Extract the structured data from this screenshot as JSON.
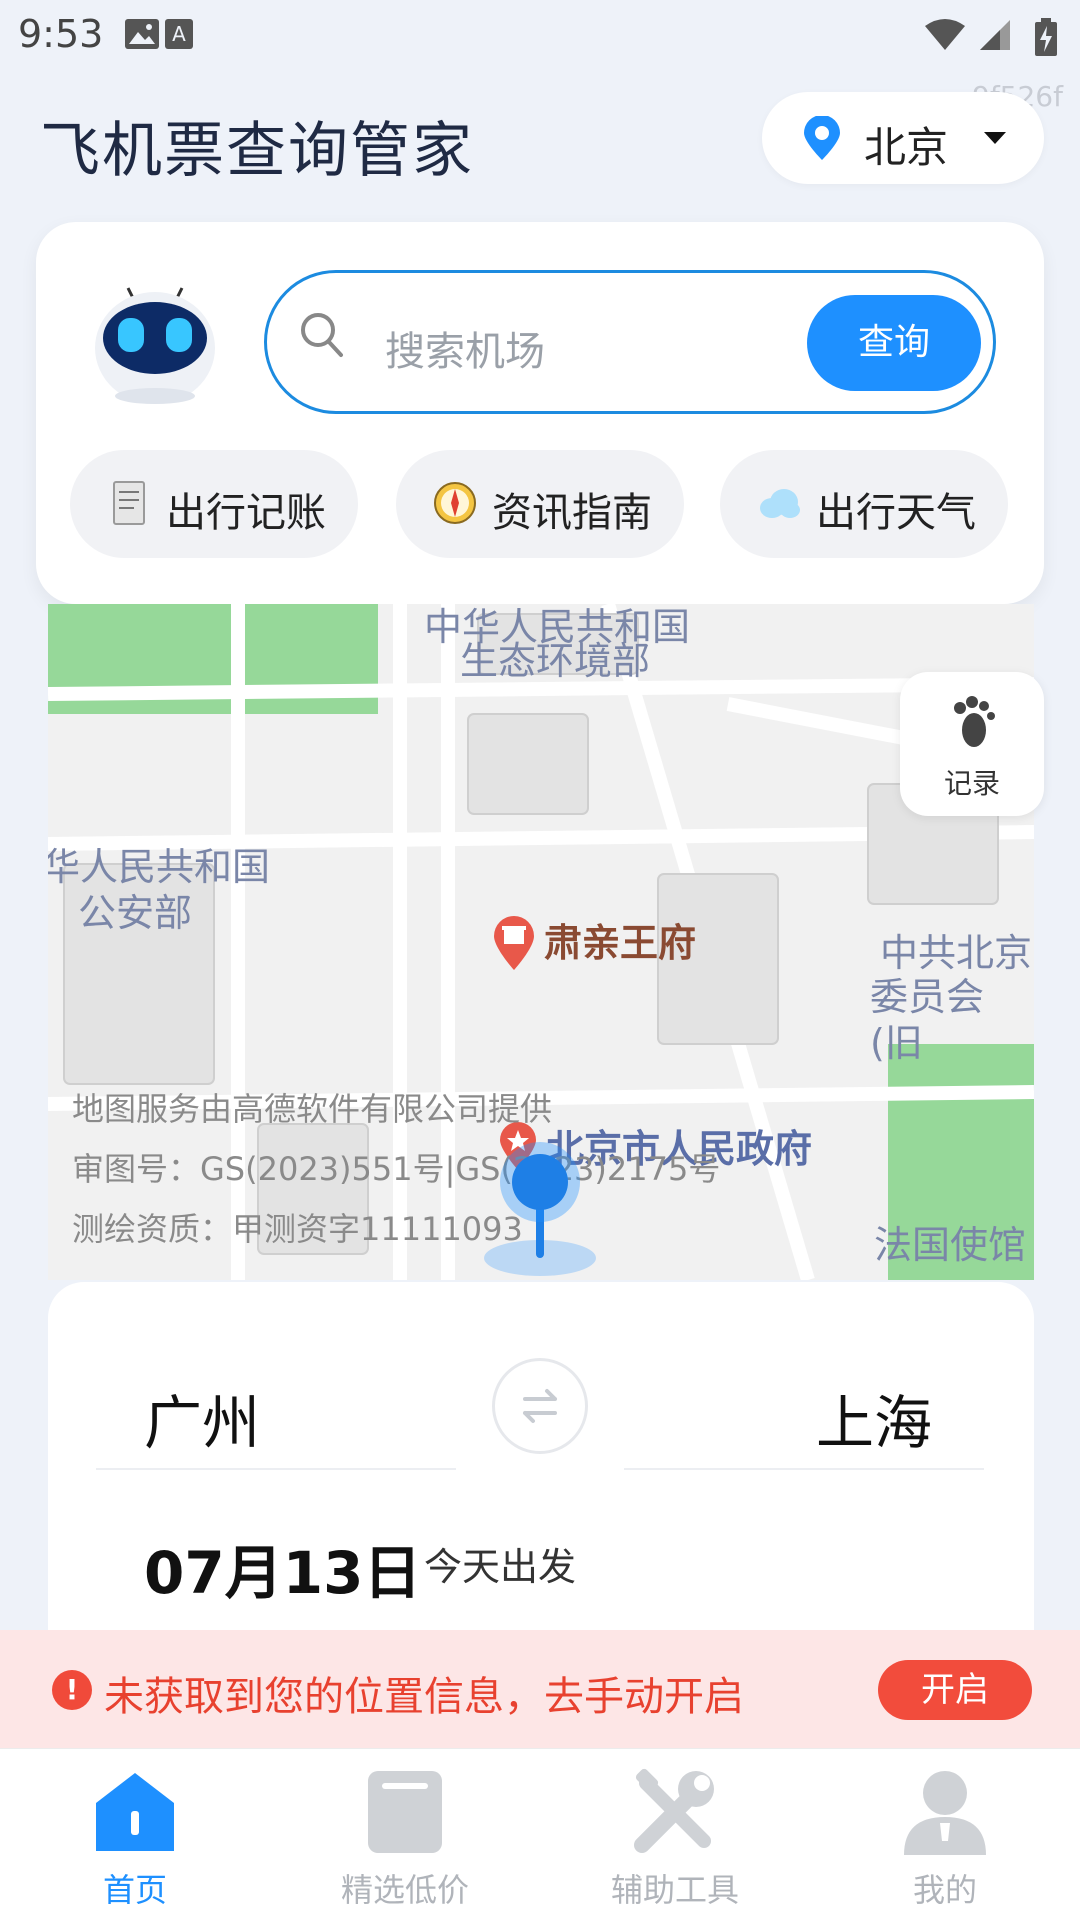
{
  "status_bar": {
    "time": "9:53"
  },
  "header": {
    "title": "飞机票查询管家",
    "city": "北京",
    "watermark": "9f526f"
  },
  "search": {
    "placeholder": "搜索机场",
    "button": "查询"
  },
  "quick_actions": [
    {
      "label": "出行记账",
      "icon": "receipt-icon"
    },
    {
      "label": "资讯指南",
      "icon": "compass-icon"
    },
    {
      "label": "出行天气",
      "icon": "cloud-icon"
    }
  ],
  "map": {
    "labels": {
      "ministry_env_line1": "中华人民共和国",
      "ministry_env_line2": "生态环境部",
      "ministry_security_line1": "华人民共和国",
      "ministry_security_line2": "公安部",
      "prince_mansion": "肃亲王府",
      "municipal_gov": "北京市人民政府",
      "party_committee_line1": "中共北京",
      "party_committee_line2": "委员会(旧",
      "embassy": "法国使馆"
    },
    "credits": [
      "地图服务由高德软件有限公司提供",
      "审图号：GS(2023)551号|GS(2023)2175号",
      "测绘资质：甲测资字11111093"
    ],
    "records_label": "记录"
  },
  "booking": {
    "from_city": "广州",
    "to_city": "上海",
    "date": "07月13日",
    "date_note": "今天出发"
  },
  "warning": {
    "text": "未获取到您的位置信息，去手动开启",
    "button": "开启"
  },
  "bottom_nav": [
    {
      "label": "首页",
      "icon": "home-icon",
      "active": true
    },
    {
      "label": "精选低价",
      "icon": "bookmark-icon",
      "active": false
    },
    {
      "label": "辅助工具",
      "icon": "tools-icon",
      "active": false
    },
    {
      "label": "我的",
      "icon": "profile-icon",
      "active": false
    }
  ],
  "colors": {
    "accent": "#1e90ff",
    "warning": "#e8412f",
    "warning_bg": "#fde6e6"
  }
}
